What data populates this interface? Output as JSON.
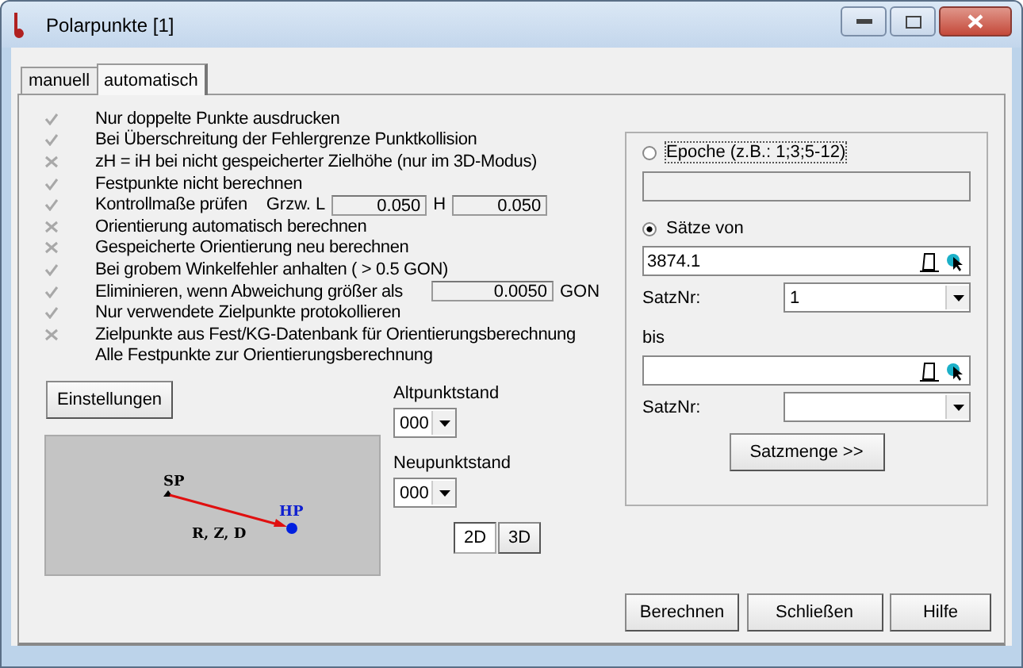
{
  "window": {
    "title": "Polarpunkte [1]"
  },
  "tabs": [
    {
      "label": "manuell",
      "selected": false
    },
    {
      "label": "automatisch",
      "selected": true
    }
  ],
  "options": [
    {
      "kind": "plain",
      "label": "Nur doppelte Punkte ausdrucken",
      "checked": true
    },
    {
      "kind": "plain",
      "label": "Bei Überschreitung der Fehlergrenze Punktkollision",
      "checked": true
    },
    {
      "kind": "plain",
      "label": "zH = iH bei nicht gespeicherter Zielhöhe (nur im 3D-Modus)",
      "checked": false
    },
    {
      "kind": "plain",
      "label": "Festpunkte nicht berechnen",
      "checked": true
    },
    {
      "kind": "tolerance",
      "label": "Kontrollmaße prüfen",
      "checked": true,
      "l_label": "Grzw. L",
      "l_value": "0.050",
      "h_label": "H",
      "h_value": "0.050"
    },
    {
      "kind": "plain",
      "label": "Orientierung automatisch berechnen",
      "checked": false
    },
    {
      "kind": "plain",
      "label": "Gespeicherte Orientierung neu berechnen",
      "checked": false
    },
    {
      "kind": "plain",
      "label": "Bei grobem Winkelfehler anhalten ( > 0.5 GON)",
      "checked": true
    },
    {
      "kind": "threshold",
      "label": "Eliminieren, wenn Abweichung größer als",
      "checked": true,
      "value": "0.0050",
      "unit": "GON"
    },
    {
      "kind": "plain",
      "label": "Nur verwendete Zielpunkte protokollieren",
      "checked": true
    },
    {
      "kind": "plain",
      "label": "Zielpunkte aus Fest/KG-Datenbank für Orientierungsberechnung",
      "checked": false
    }
  ],
  "note": "Alle Festpunkte zur Orientierungsberechnung",
  "settings_button": "Einstellungen",
  "diagram": {
    "start_label": "SP",
    "end_label": "HP",
    "edge_label": "R, Z, D"
  },
  "altpunktstand": {
    "label": "Altpunktstand",
    "value": "000"
  },
  "neupunktstand": {
    "label": "Neupunktstand",
    "value": "000"
  },
  "mode_buttons": [
    {
      "label": "2D",
      "selected": true
    },
    {
      "label": "3D",
      "selected": false
    }
  ],
  "sources": [
    {
      "label": "Epoche (z.B.: 1;3;5-12)",
      "selected": false
    },
    {
      "label": "Sätze von",
      "selected": true
    }
  ],
  "from": {
    "value": "3874.1",
    "satznr_label": "SatzNr:",
    "satznr_value": "1"
  },
  "to": {
    "label": "bis",
    "satznr_label": "SatzNr:"
  },
  "satzmenge_button": "Satzmenge >>",
  "buttons": [
    "Berechnen",
    "Schließen",
    "Hilfe"
  ]
}
